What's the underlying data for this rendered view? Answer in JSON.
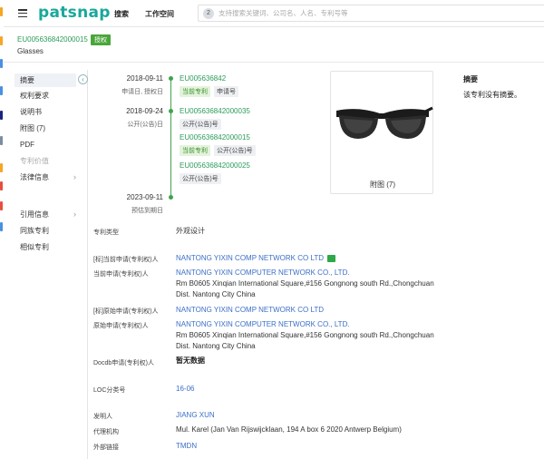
{
  "app": {
    "logo": "patsnap",
    "nav": [
      "搜索",
      "工作空间"
    ],
    "search": {
      "badge": "2",
      "placeholder": "支持搜索关键词、公司名、人名、专利号等"
    }
  },
  "doc": {
    "id": "EU005636842000015",
    "badge": "授权",
    "title": "Glasses"
  },
  "sidebar": {
    "items": [
      {
        "label": "摘要",
        "active": true
      },
      {
        "label": "权利要求"
      },
      {
        "label": "说明书"
      },
      {
        "label": "附图 (7)"
      },
      {
        "label": "PDF"
      },
      {
        "label": "专利价值",
        "muted": true
      },
      {
        "label": "法律信息",
        "chevron": true
      },
      {
        "label": "引用信息",
        "chevron": true
      },
      {
        "label": "同族专利"
      },
      {
        "label": "相似专利"
      }
    ]
  },
  "timeline": {
    "entries": [
      {
        "date": "2018-09-11",
        "sub": "申请日, 授权日"
      },
      {
        "date": "2018-09-24",
        "sub": "公开(公告)日"
      },
      {
        "date": "2023-09-11",
        "sub": "预估到期日"
      }
    ],
    "links": [
      "EU005636842",
      "EU005636842000035",
      "EU005636842000015",
      "EU005636842000025"
    ],
    "tags": {
      "current": "当前专利",
      "app_no": "申请号",
      "pub_no": "公开(公告)号"
    }
  },
  "figure": {
    "caption": "附图 (7)"
  },
  "abstract": {
    "title": "摘要",
    "text": "该专利没有摘要。"
  },
  "fields": {
    "type_label": "专利类型",
    "type_value": "外观设计",
    "assignee_label": "[标]当前申请(专利权)人",
    "assignee_value": "NANTONG YIXIN COMP NETWORK CO LTD",
    "cur_applicant_label": "当前申请(专利权)人",
    "cur_applicant_value": "NANTONG YIXIN COMPUTER NETWORK CO., LTD.",
    "cur_address_1": "Rm B0605 Xinqian International Square,#156 Gongnong south Rd.,Chongchuan",
    "cur_address_2": "Dist. Nantong City China",
    "orig_assignee_label": "[标]原始申请(专利权)人",
    "orig_assignee_value": "NANTONG YIXIN COMP NETWORK CO LTD",
    "orig_applicant_label": "原始申请(专利权)人",
    "orig_applicant_value": "NANTONG YIXIN COMPUTER NETWORK CO., LTD.",
    "orig_address_1": "Rm B0605 Xinqian International Square,#156 Gongnong south Rd.,Chongchuan",
    "orig_address_2": "Dist. Nantong City China",
    "docdb_label": "Docdb申请(专利权)人",
    "docdb_value": "暂无数据",
    "loc_label": "LOC分类号",
    "loc_value": "16-06",
    "inventor_label": "发明人",
    "inventor_value": "JIANG XUN",
    "agency_label": "代理机构",
    "agency_value": "Mul. Karel (Jan Van Rijswijcklaan, 194 A box 6 2020 Antwerp Belgium)",
    "ext_label": "外部链接",
    "ext_value": "TMDN"
  }
}
